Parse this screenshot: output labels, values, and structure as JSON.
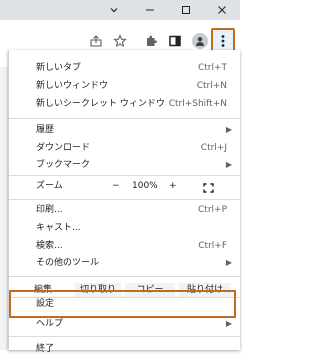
{
  "window": {
    "controls": [
      "chevron-down",
      "minimize",
      "maximize",
      "close"
    ]
  },
  "toolbar": {
    "icons": [
      "share-icon",
      "star-icon",
      "extensions-icon",
      "side-panel-icon",
      "profile-icon",
      "more-icon"
    ],
    "highlight_color": "#c26a1e"
  },
  "menu": {
    "new_tab": {
      "label": "新しいタブ",
      "shortcut": "Ctrl+T"
    },
    "new_window": {
      "label": "新しいウィンドウ",
      "shortcut": "Ctrl+N"
    },
    "new_incognito": {
      "label": "新しいシークレット ウィンドウ",
      "shortcut": "Ctrl+Shift+N"
    },
    "history": {
      "label": "履歴"
    },
    "downloads": {
      "label": "ダウンロード",
      "shortcut": "Ctrl+J"
    },
    "bookmarks": {
      "label": "ブックマーク"
    },
    "zoom": {
      "label": "ズーム",
      "minus": "−",
      "value": "100%",
      "plus": "+"
    },
    "print": {
      "label": "印刷...",
      "shortcut": "Ctrl+P"
    },
    "cast": {
      "label": "キャスト..."
    },
    "find": {
      "label": "検索...",
      "shortcut": "Ctrl+F"
    },
    "more_tools": {
      "label": "その他のツール"
    },
    "edit": {
      "label": "編集",
      "cut": "切り取り",
      "copy": "コピー",
      "paste": "貼り付け"
    },
    "settings": {
      "label": "設定"
    },
    "help": {
      "label": "ヘルプ"
    },
    "exit": {
      "label": "終了"
    }
  }
}
